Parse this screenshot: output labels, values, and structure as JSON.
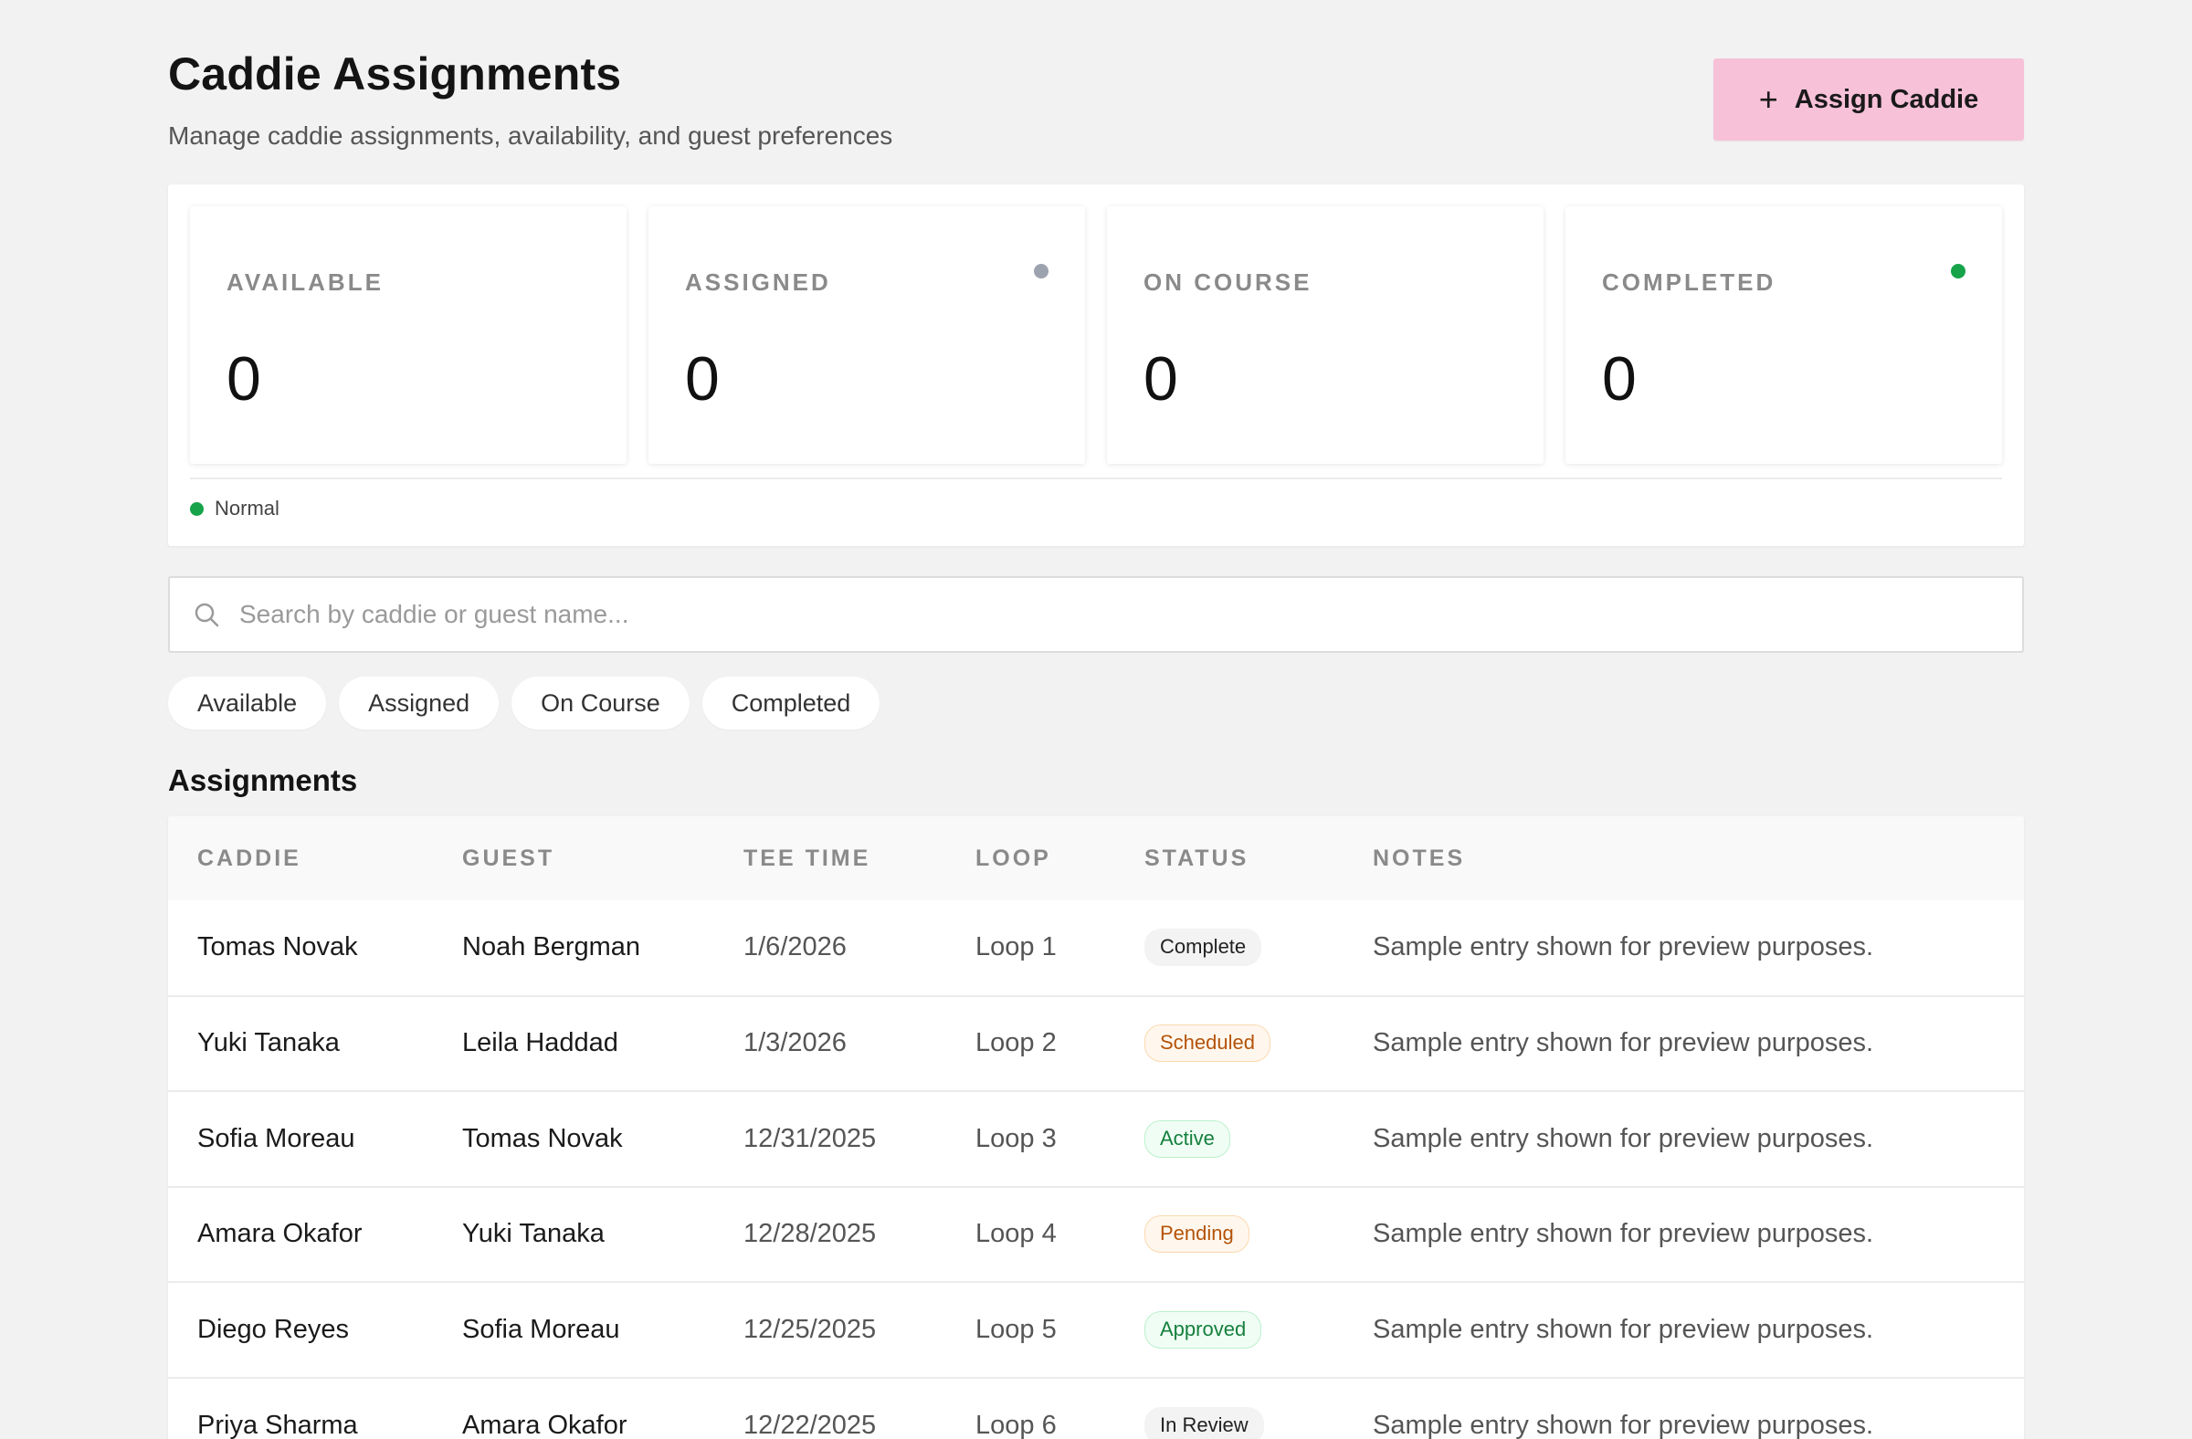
{
  "header": {
    "title": "Caddie Assignments",
    "subtitle": "Manage caddie assignments, availability, and guest preferences",
    "assign_button": "Assign Caddie",
    "assign_button_icon": "plus-icon"
  },
  "stats": [
    {
      "label": "AVAILABLE",
      "value": "0",
      "dot": null
    },
    {
      "label": "ASSIGNED",
      "value": "0",
      "dot": "#9ca3af"
    },
    {
      "label": "ON COURSE",
      "value": "0",
      "dot": null
    },
    {
      "label": "COMPLETED",
      "value": "0",
      "dot": "#16a34a"
    }
  ],
  "legend": {
    "label": "Normal",
    "color": "#16a34a"
  },
  "search": {
    "placeholder": "Search by caddie or guest name...",
    "value": "",
    "icon": "search-icon"
  },
  "filters": [
    "Available",
    "Assigned",
    "On Course",
    "Completed"
  ],
  "section_title": "Assignments",
  "table": {
    "columns": [
      "CADDIE",
      "GUEST",
      "TEE TIME",
      "LOOP",
      "STATUS",
      "NOTES"
    ],
    "rows": [
      {
        "caddie": "Tomas Novak",
        "guest": "Noah Bergman",
        "tee_time": "1/6/2026",
        "loop": "Loop 1",
        "status": "Complete",
        "notes": "Sample entry shown for preview purposes."
      },
      {
        "caddie": "Yuki Tanaka",
        "guest": "Leila Haddad",
        "tee_time": "1/3/2026",
        "loop": "Loop 2",
        "status": "Scheduled",
        "notes": "Sample entry shown for preview purposes."
      },
      {
        "caddie": "Sofia Moreau",
        "guest": "Tomas Novak",
        "tee_time": "12/31/2025",
        "loop": "Loop 3",
        "status": "Active",
        "notes": "Sample entry shown for preview purposes."
      },
      {
        "caddie": "Amara Okafor",
        "guest": "Yuki Tanaka",
        "tee_time": "12/28/2025",
        "loop": "Loop 4",
        "status": "Pending",
        "notes": "Sample entry shown for preview purposes."
      },
      {
        "caddie": "Diego Reyes",
        "guest": "Sofia Moreau",
        "tee_time": "12/25/2025",
        "loop": "Loop 5",
        "status": "Approved",
        "notes": "Sample entry shown for preview purposes."
      },
      {
        "caddie": "Priya Sharma",
        "guest": "Amara Okafor",
        "tee_time": "12/22/2025",
        "loop": "Loop 6",
        "status": "In Review",
        "notes": "Sample entry shown for preview purposes."
      }
    ]
  },
  "status_colors": {
    "Complete": {
      "bg": "#f3f3f3",
      "border": "#f3f3f3",
      "fg": "#222222"
    },
    "Scheduled": {
      "bg": "#fff7ed",
      "border": "#fcd9b0",
      "fg": "#b45309"
    },
    "Active": {
      "bg": "#f0fdf4",
      "border": "#bbf0cd",
      "fg": "#15803d"
    },
    "Pending": {
      "bg": "#fff7ed",
      "border": "#fcd9b0",
      "fg": "#b45309"
    },
    "Approved": {
      "bg": "#f0fdf4",
      "border": "#bbf0cd",
      "fg": "#15803d"
    },
    "In Review": {
      "bg": "#f3f3f3",
      "border": "#f3f3f3",
      "fg": "#222222"
    }
  }
}
